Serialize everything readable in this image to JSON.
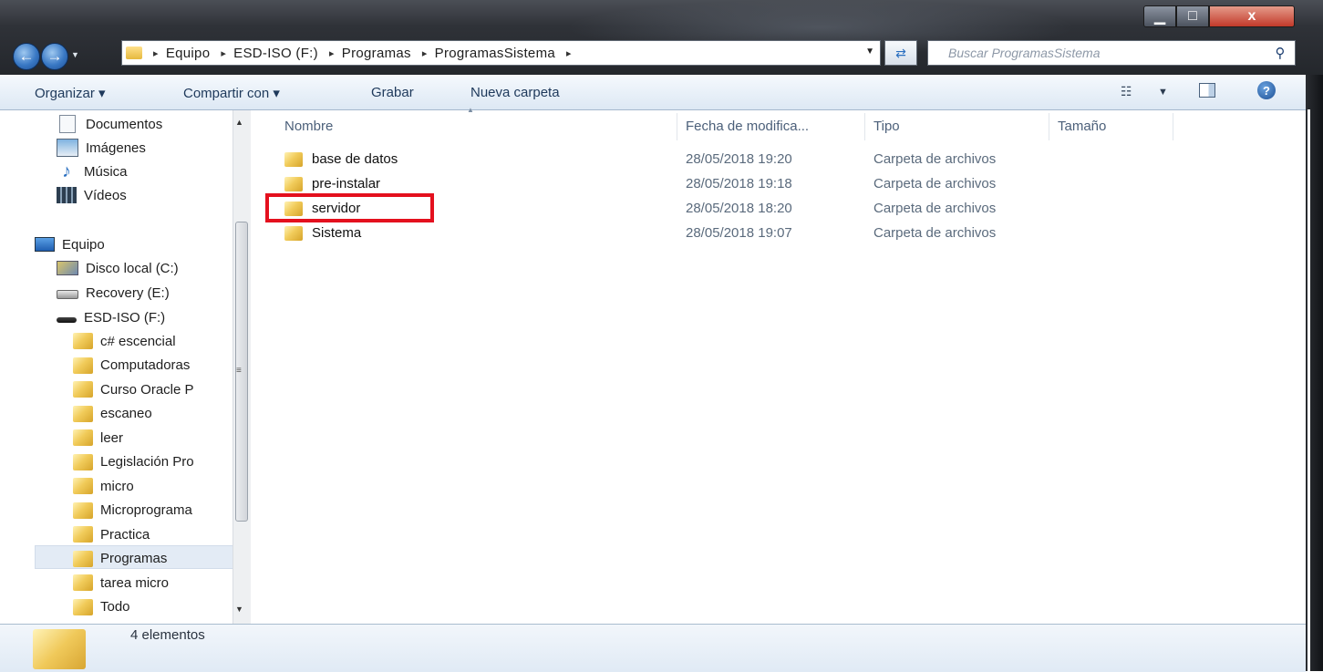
{
  "window": {
    "min_glyph": "▁",
    "max_glyph": "□",
    "close_glyph": "x"
  },
  "address_bar": {
    "crumbs": [
      "Equipo",
      "ESD-ISO (F:)",
      "Programas",
      "ProgramasSistema"
    ],
    "separator": "▸"
  },
  "search": {
    "placeholder": "Buscar ProgramasSistema"
  },
  "toolbar": {
    "organizar": "Organizar ▾",
    "compartir": "Compartir con ▾",
    "grabar": "Grabar",
    "nueva_carpeta": "Nueva carpeta"
  },
  "nav_pane": {
    "favorites": [
      {
        "label": "Documentos",
        "icon": "document-icon"
      },
      {
        "label": "Imágenes",
        "icon": "pictures-icon"
      },
      {
        "label": "Música",
        "icon": "music-icon"
      },
      {
        "label": "Vídeos",
        "icon": "video-icon"
      }
    ],
    "computer": {
      "label": "Equipo",
      "icon": "computer-icon"
    },
    "drives": [
      {
        "label": "Disco local (C:)",
        "icon": "local-disk-icon"
      },
      {
        "label": "Recovery (E:)",
        "icon": "drive-icon"
      },
      {
        "label": "ESD-ISO (F:)",
        "icon": "optical-drive-icon"
      }
    ],
    "folders": [
      "c# escencial",
      "Computadoras",
      "Curso Oracle P",
      "escaneo",
      "leer",
      "Legislación Pro",
      "micro",
      "Microprograma",
      "Practica",
      "Programas",
      "tarea micro",
      "Todo"
    ],
    "selected": "Programas"
  },
  "columns": {
    "name": "Nombre",
    "date": "Fecha de modifica...",
    "type": "Tipo",
    "size": "Tamaño"
  },
  "files": [
    {
      "name": "base de datos",
      "date": "28/05/2018 19:20",
      "type": "Carpeta de archivos",
      "size": ""
    },
    {
      "name": "pre-instalar",
      "date": "28/05/2018 19:18",
      "type": "Carpeta de archivos",
      "size": ""
    },
    {
      "name": "servidor",
      "date": "28/05/2018 18:20",
      "type": "Carpeta de archivos",
      "size": ""
    },
    {
      "name": "Sistema",
      "date": "28/05/2018 19:07",
      "type": "Carpeta de archivos",
      "size": ""
    }
  ],
  "highlighted_file": "servidor",
  "highlight_color": "#e4101e",
  "status": {
    "count": "4 elementos"
  }
}
